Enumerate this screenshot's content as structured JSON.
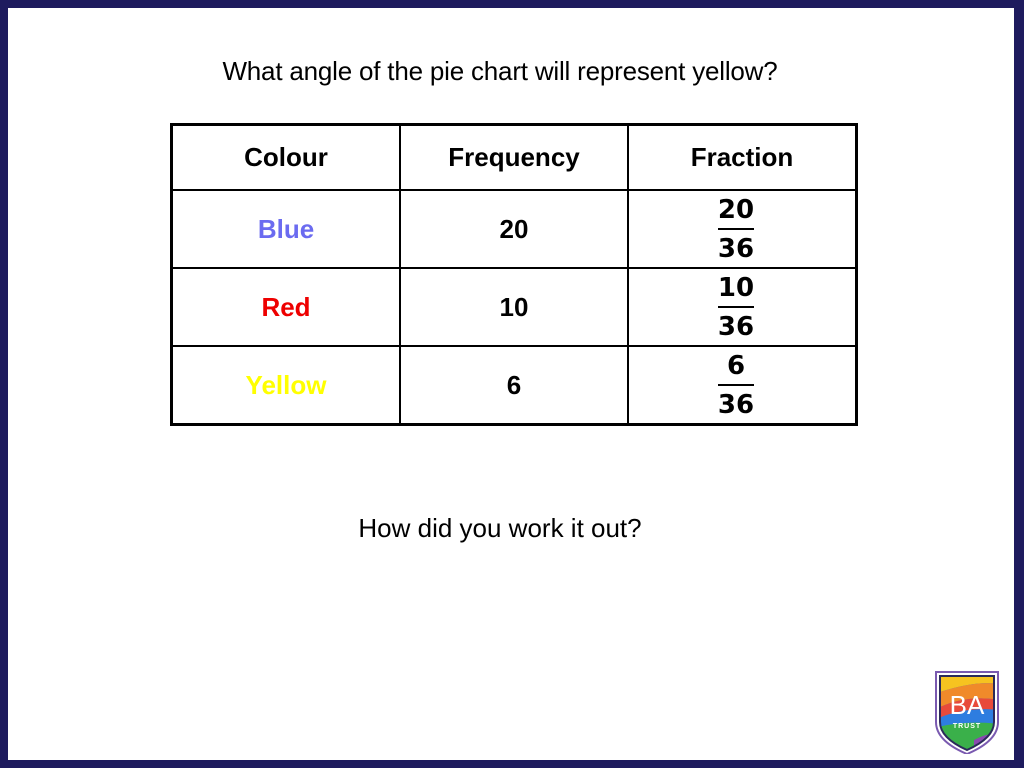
{
  "question": "What angle of the pie chart will represent yellow?",
  "table": {
    "headers": [
      "Colour",
      "Frequency",
      "Fraction"
    ],
    "rows": [
      {
        "colour": "Blue",
        "color_hex": "#6b6bf0",
        "frequency": "20",
        "numerator": "20",
        "denominator": "36"
      },
      {
        "colour": "Red",
        "color_hex": "#ee0000",
        "frequency": "10",
        "numerator": "10",
        "denominator": "36"
      },
      {
        "colour": "Yellow",
        "color_hex": "#ffff00",
        "frequency": "6",
        "numerator": "6",
        "denominator": "36"
      }
    ]
  },
  "followup": "How did you work it out?",
  "logo": {
    "initials": "BA",
    "subtitle": "TRUST"
  },
  "colors": {
    "frame": "#1e1b5e",
    "background": "#ffffff"
  }
}
